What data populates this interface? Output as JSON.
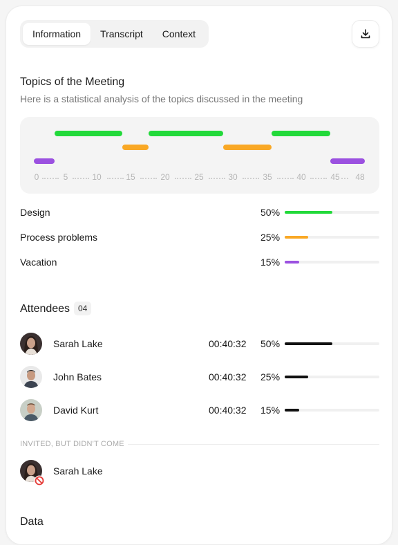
{
  "tabs": [
    {
      "label": "Information",
      "active": true
    },
    {
      "label": "Transcript",
      "active": false
    },
    {
      "label": "Context",
      "active": false
    }
  ],
  "download_icon": "download-icon",
  "topics": {
    "title": "Topics of the Meeting",
    "subtitle": "Here is a statistical analysis of the topics discussed in the meeting",
    "axis_ticks": [
      "0",
      "5",
      "10",
      "15",
      "20",
      "25",
      "30",
      "35",
      "40",
      "45",
      "48"
    ],
    "items": [
      {
        "name": "Design",
        "percent_label": "50%",
        "percent": 50,
        "color": "#22d93a"
      },
      {
        "name": "Process problems",
        "percent_label": "25%",
        "percent": 25,
        "color": "#f9a825"
      },
      {
        "name": "Vacation",
        "percent_label": "15%",
        "percent": 15,
        "color": "#9b51e0"
      }
    ]
  },
  "attendees": {
    "title": "Attendees",
    "count": "04",
    "people": [
      {
        "name": "Sarah Lake",
        "time": "00:40:32",
        "percent_label": "50%",
        "percent": 50
      },
      {
        "name": "John Bates",
        "time": "00:40:32",
        "percent_label": "25%",
        "percent": 25
      },
      {
        "name": "David Kurt",
        "time": "00:40:32",
        "percent_label": "15%",
        "percent": 15
      }
    ],
    "invited_label": "INVITED, BUT DIDN'T COME",
    "absent": [
      {
        "name": "Sarah Lake"
      }
    ]
  },
  "data_section": {
    "title": "Data"
  }
}
